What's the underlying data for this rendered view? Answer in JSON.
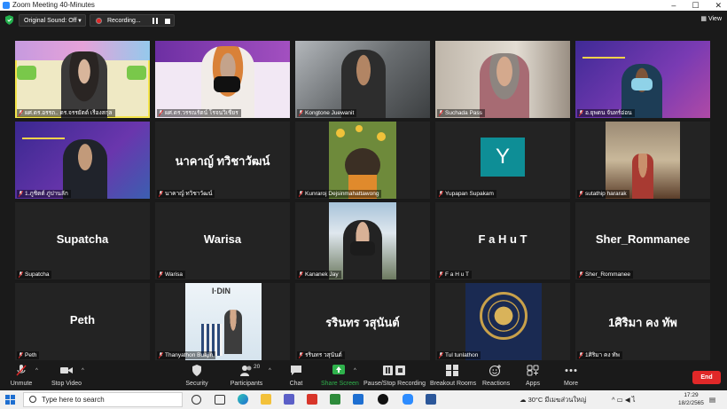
{
  "window": {
    "title": "Zoom Meeting 40-Minutes"
  },
  "topbar": {
    "original_sound": "Original Sound: Off",
    "recording": "Recording...",
    "view": "View"
  },
  "tiles": [
    {
      "name": "ผศ.ดร.อรรถ.. ดร.จรรยัตต์ เรืองสกุล",
      "active": true
    },
    {
      "name": "ผศ.ดร.วรรณรัตน์ โรจนวิเชียร"
    },
    {
      "name": "Kongtone Juewanit"
    },
    {
      "name": "Suchada Pass"
    },
    {
      "name": "อ.ยุพดน จันทร์อ่อน"
    },
    {
      "name": "1.ภูชิตต์ ภู่ปานลัก"
    },
    {
      "name": "นาคาญ์ ทวิชาวัฒน์",
      "display": "นาคาญ์ ทวิชาวัฒน์"
    },
    {
      "name": "Kunraroj Dejsinmahattawong"
    },
    {
      "name": "Yupapan Supakam",
      "initial": "Y"
    },
    {
      "name": "sutathip hararak"
    },
    {
      "name": "Supatcha",
      "display": "Supatcha"
    },
    {
      "name": "Warisa",
      "display": "Warisa"
    },
    {
      "name": "Kananek Jay"
    },
    {
      "name": "F a H u T",
      "display": "F a H u T"
    },
    {
      "name": "Sher_Rommanee",
      "display": "Sher_Rommanee"
    },
    {
      "name": "Peth",
      "display": "Peth"
    },
    {
      "name": "Thanyathon Buajin"
    },
    {
      "name": "รรินทร วสุนันต์",
      "display": "รรินทร วสุนันต์"
    },
    {
      "name": "Tul tunlathon"
    },
    {
      "name": "1ศิริมา คง ทัพ",
      "display": "1ศิริมา คง ทัพ"
    }
  ],
  "toolbar": {
    "unmute": "Unmute",
    "stop_video": "Stop Video",
    "security": "Security",
    "participants": "Participants",
    "participants_count": "20",
    "chat": "Chat",
    "share_screen": "Share Screen",
    "pause_recording": "Pause/Stop Recording",
    "breakout": "Breakout Rooms",
    "reactions": "Reactions",
    "apps": "Apps",
    "more": "More",
    "end": "End"
  },
  "taskbar": {
    "search_placeholder": "Type here to search",
    "weather": "30°C มีเมฆส่วนใหญ่",
    "time": "17:29",
    "date": "18/2/2565"
  },
  "colors": {
    "active_speaker": "#f4e44a",
    "share_green": "#2fb24c",
    "end_red": "#e02828",
    "avatar_teal": "#0e8e96"
  }
}
